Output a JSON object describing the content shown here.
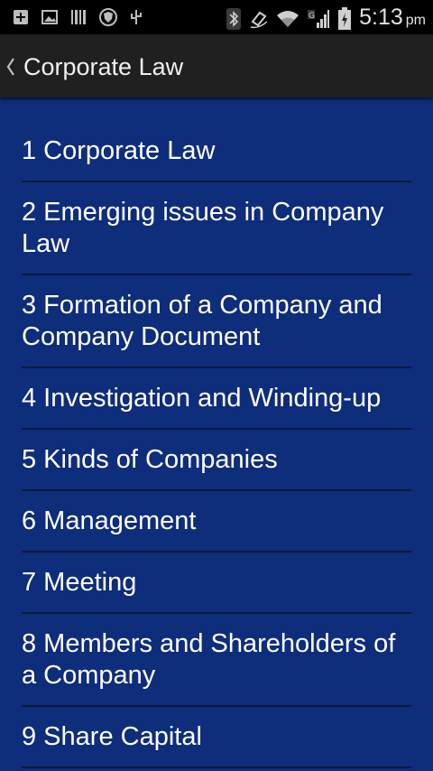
{
  "status_bar": {
    "time": "5:13",
    "ampm": "pm",
    "icons": [
      "add-box-icon",
      "image-icon",
      "barcode-icon",
      "shield-icon",
      "usb-icon",
      "bluetooth-icon",
      "nfc-icon",
      "wifi-icon",
      "signal-icon",
      "battery-charging-icon"
    ]
  },
  "action_bar": {
    "title": "Corporate Law"
  },
  "colors": {
    "background": "#0e2d7a",
    "action_bar": "#202020",
    "status_bar": "#000000",
    "divider": "#0a1a3a",
    "text": "#ffffff"
  },
  "list": {
    "items": [
      "1 Corporate Law",
      "2 Emerging issues in Company Law",
      "3 Formation of a Company and Company Document",
      "4 Investigation and Winding-up",
      "5 Kinds of Companies",
      "6 Management",
      "7 Meeting",
      "8 Members and Shareholders of a Company",
      "9 Share Capital"
    ]
  }
}
